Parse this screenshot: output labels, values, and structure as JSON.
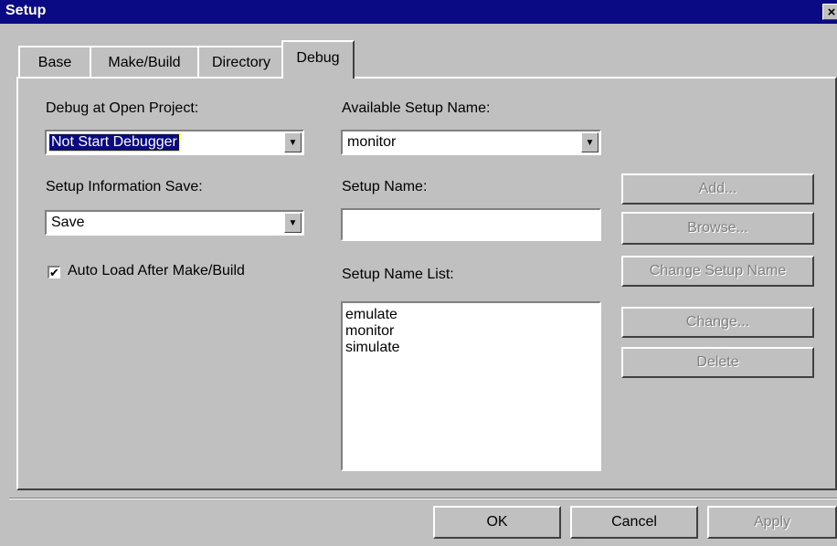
{
  "window": {
    "title": "Setup",
    "close_glyph": "×"
  },
  "tabs": [
    {
      "label": "Base"
    },
    {
      "label": "Make/Build"
    },
    {
      "label": "Directory"
    },
    {
      "label": "Debug",
      "active": true
    }
  ],
  "debug": {
    "debug_at_open_label": "Debug at Open Project:",
    "debug_at_open_value": "Not Start Debugger",
    "setup_info_save_label": "Setup Information Save:",
    "setup_info_save_value": "Save",
    "auto_load_label": "Auto Load After Make/Build",
    "auto_load_checked": true,
    "available_setup_label": "Available Setup Name:",
    "available_setup_value": "monitor",
    "setup_name_label": "Setup Name:",
    "setup_name_value": "",
    "setup_name_list_label": "Setup Name List:",
    "setup_name_list": [
      "emulate",
      "monitor",
      "simulate"
    ]
  },
  "side_buttons": {
    "add": "Add...",
    "browse": "Browse...",
    "change_setup_name": "Change Setup Name",
    "change": "Change...",
    "delete": "Delete"
  },
  "footer_buttons": {
    "ok": "OK",
    "cancel": "Cancel",
    "apply": "Apply"
  },
  "icons": {
    "checkmark": "✔",
    "dropdown_arrow": "▼"
  }
}
